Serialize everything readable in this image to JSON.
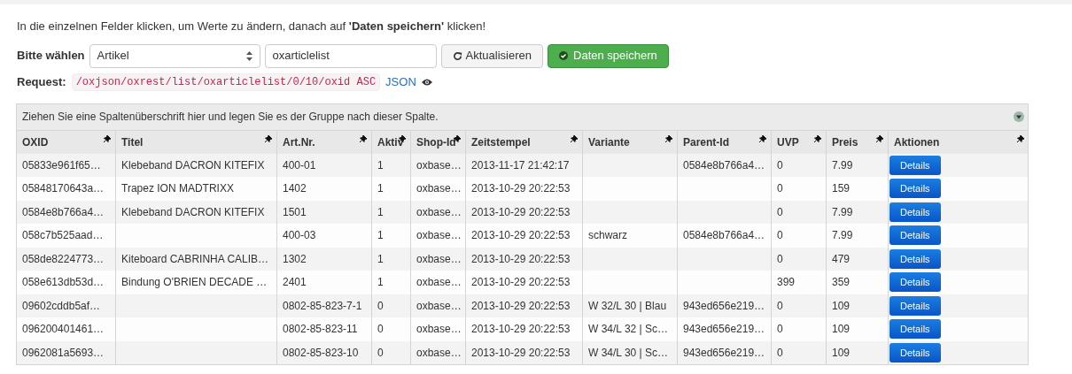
{
  "instruction": "In die einzelnen Felder klicken, um Werte zu ändern, danach auf **'Daten speichern'** klicken!",
  "form": {
    "label": "Bitte wählen",
    "select": {
      "value": "Artikel"
    },
    "list_field": {
      "value": "oxarticlelist"
    },
    "buttons": [
      {
        "kind": "refresh",
        "label": "Aktualisieren"
      },
      {
        "kind": "save",
        "label": "Daten speichern"
      }
    ]
  },
  "request": {
    "label": "Request:",
    "path": "/oxjson/oxrest/list/oxarticlelist/0/10/oxid ASC",
    "link": "JSON"
  },
  "grid": {
    "group_hint": "Ziehen Sie eine Spaltenüberschrift hier und legen Sie es der Gruppe nach dieser Spalte.",
    "columns": [
      "OXID",
      "Titel",
      "Art.Nr.",
      "Aktiv",
      "Shop-Id",
      "Zeitstempel",
      "Variante",
      "Parent-Id",
      "UVP",
      "Preis",
      "Aktionen"
    ],
    "rows": [
      {
        "cells": [
          "05833e961f65…",
          "Klebeband DACRON KITEFIX",
          "400-01",
          "1",
          "oxbase…",
          "2013-11-17 21:42:17",
          "",
          "0584e8b766a4…",
          "0",
          "7.99"
        ],
        "action": "Details"
      },
      {
        "cells": [
          "05848170643a…",
          "Trapez ION MADTRIXX",
          "1402",
          "1",
          "oxbase…",
          "2013-10-29 20:22:53",
          "",
          "",
          "0",
          "159"
        ],
        "action": "Details"
      },
      {
        "cells": [
          "0584e8b766a4…",
          "Klebeband DACRON KITEFIX",
          "1501",
          "1",
          "oxbase…",
          "2013-10-29 20:22:53",
          "",
          "",
          "0",
          "7.99"
        ],
        "action": "Details"
      },
      {
        "cells": [
          "058c7b525aad…",
          "",
          "400-03",
          "1",
          "oxbase…",
          "2013-10-29 20:22:53",
          "schwarz",
          "0584e8b766a4…",
          "0",
          "7.99"
        ],
        "action": "Details"
      },
      {
        "cells": [
          "058de8224773…",
          "Kiteboard CABRINHA CALIB…",
          "1302",
          "1",
          "oxbase…",
          "2013-10-29 20:22:53",
          "",
          "",
          "0",
          "479"
        ],
        "action": "Details"
      },
      {
        "cells": [
          "058e613db53d…",
          "Bindung O'BRIEN DECADE …",
          "2401",
          "1",
          "oxbase…",
          "2013-10-29 20:22:53",
          "",
          "",
          "399",
          "359"
        ],
        "action": "Details"
      },
      {
        "cells": [
          "09602cddb5af…",
          "",
          "0802-85-823-7-1",
          "0",
          "oxbase…",
          "2013-10-29 20:22:53",
          "W 32/L 30 | Blau",
          "943ed656e219…",
          "0",
          "109"
        ],
        "action": "Details"
      },
      {
        "cells": [
          "096200401461…",
          "",
          "0802-85-823-11",
          "0",
          "oxbase…",
          "2013-10-29 20:22:53",
          "W 34/L 32 | Sc…",
          "943ed656e219…",
          "0",
          "109"
        ],
        "action": "Details"
      },
      {
        "cells": [
          "0962081a5693…",
          "",
          "0802-85-823-10",
          "0",
          "oxbase…",
          "2013-10-29 20:22:53",
          "W 34/L 30 | Sc…",
          "943ed656e219…",
          "0",
          "109"
        ],
        "action": "Details"
      }
    ]
  }
}
